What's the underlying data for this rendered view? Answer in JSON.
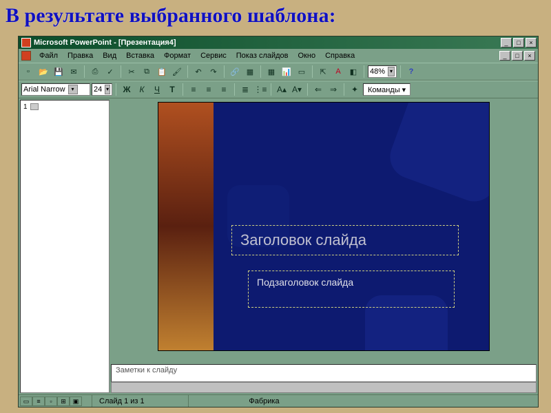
{
  "heading": "В результате выбранного шаблона:",
  "titlebar": {
    "text": "Microsoft PowerPoint - [Презентация4]",
    "min": "_",
    "max": "□",
    "close": "×"
  },
  "menu": {
    "items": [
      "Файл",
      "Правка",
      "Вид",
      "Вставка",
      "Формат",
      "Сервис",
      "Показ слайдов",
      "Окно",
      "Справка"
    ],
    "doc_min": "_",
    "doc_max": "□",
    "doc_close": "×"
  },
  "toolbar1": {
    "zoom": "48%",
    "help": "?"
  },
  "toolbar2": {
    "font": "Arial Narrow",
    "size": "24",
    "bold": "Ж",
    "italic": "К",
    "underline": "Ч",
    "commands": "Команды ▾"
  },
  "thumbs": {
    "num1": "1"
  },
  "slide": {
    "title_placeholder": "Заголовок слайда",
    "subtitle_placeholder": "Подзаголовок слайда"
  },
  "notes": {
    "placeholder": "Заметки к слайду"
  },
  "status": {
    "slide": "Слайд 1 из 1",
    "template": "Фабрика"
  }
}
